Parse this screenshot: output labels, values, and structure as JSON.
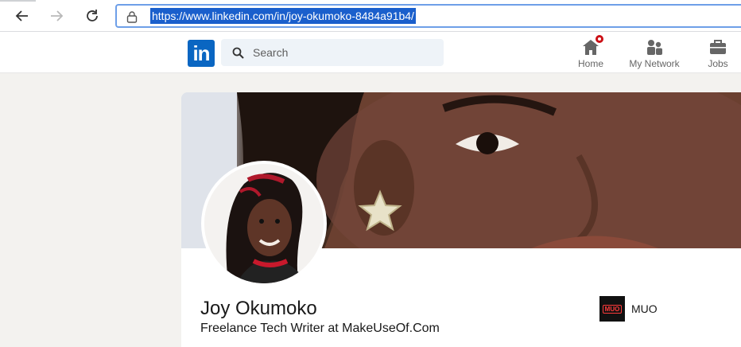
{
  "browser": {
    "url": "https://www.linkedin.com/in/joy-okumoko-8484a91b4/",
    "icons": {
      "back": "arrow-left-icon",
      "forward": "arrow-right-icon",
      "reload": "reload-icon",
      "lock": "lock-icon"
    }
  },
  "header": {
    "logo_text": "in",
    "search_placeholder": "Search",
    "nav": [
      {
        "label": "Home",
        "icon": "home-icon",
        "has_notification": true
      },
      {
        "label": "My Network",
        "icon": "network-icon"
      },
      {
        "label": "Jobs",
        "icon": "briefcase-icon"
      }
    ],
    "colors": {
      "brand": "#0a66c2",
      "notification": "#cc1016"
    }
  },
  "profile": {
    "name": "Joy Okumoko",
    "headline": "Freelance Tech Writer at MakeUseOf.Com",
    "company": {
      "name": "MUO",
      "logo_text": "MUO",
      "logo_color": "#111111",
      "accent": "#ff3b3b"
    }
  }
}
